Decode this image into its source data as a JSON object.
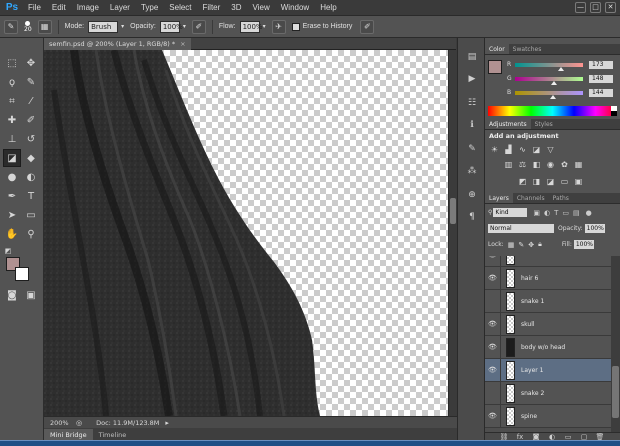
{
  "app": {
    "logo": "Ps"
  },
  "menu": [
    "File",
    "Edit",
    "Image",
    "Layer",
    "Type",
    "Select",
    "Filter",
    "3D",
    "View",
    "Window",
    "Help"
  ],
  "window_controls": [
    "—",
    "□",
    "✕"
  ],
  "options_bar": {
    "brush_size": "20",
    "mode_label": "Mode:",
    "mode_value": "Brush",
    "opacity_label": "Opacity:",
    "opacity_value": "100%",
    "flow_label": "Flow:",
    "flow_value": "100%",
    "erase_to_history_label": "Erase to History"
  },
  "document": {
    "tab_title": "semfin.psd @ 200% (Layer 1, RGB/8) *",
    "zoom": "200%",
    "doc_info": "Doc: 11.9M/123.8M"
  },
  "bottom_tabs": [
    "Mini Bridge",
    "Timeline"
  ],
  "colors": {
    "foreground": "#b09191",
    "background": "#ffffff",
    "accent": "#5d6e84",
    "ps_blue": "#31a8ff"
  },
  "color_panel": {
    "tabs": [
      "Color",
      "Swatches"
    ],
    "sliders": [
      {
        "label": "R",
        "value": "173",
        "level": 0.68
      },
      {
        "label": "G",
        "value": "148",
        "level": 0.58
      },
      {
        "label": "B",
        "value": "144",
        "level": 0.56
      }
    ]
  },
  "adjustments_panel": {
    "tabs": [
      "Adjustments",
      "Styles"
    ],
    "heading": "Add an adjustment"
  },
  "layers_panel": {
    "tabs": [
      "Layers",
      "Channels",
      "Paths"
    ],
    "filter_kind": "Kind",
    "blend_mode": "Normal",
    "opacity_label": "Opacity:",
    "opacity_value": "100%",
    "lock_label": "Lock:",
    "fill_label": "Fill:",
    "fill_value": "100%",
    "layers": [
      {
        "name": "hair 6",
        "visible": true,
        "selected": false,
        "dark": false
      },
      {
        "name": "snake 1",
        "visible": false,
        "selected": false,
        "dark": false
      },
      {
        "name": "skull",
        "visible": true,
        "selected": false,
        "dark": false
      },
      {
        "name": "body w/o head",
        "visible": true,
        "selected": false,
        "dark": true
      },
      {
        "name": "Layer 1",
        "visible": true,
        "selected": true,
        "dark": false
      },
      {
        "name": "snake 2",
        "visible": false,
        "selected": false,
        "dark": false
      },
      {
        "name": "spine",
        "visible": true,
        "selected": false,
        "dark": false
      }
    ]
  }
}
